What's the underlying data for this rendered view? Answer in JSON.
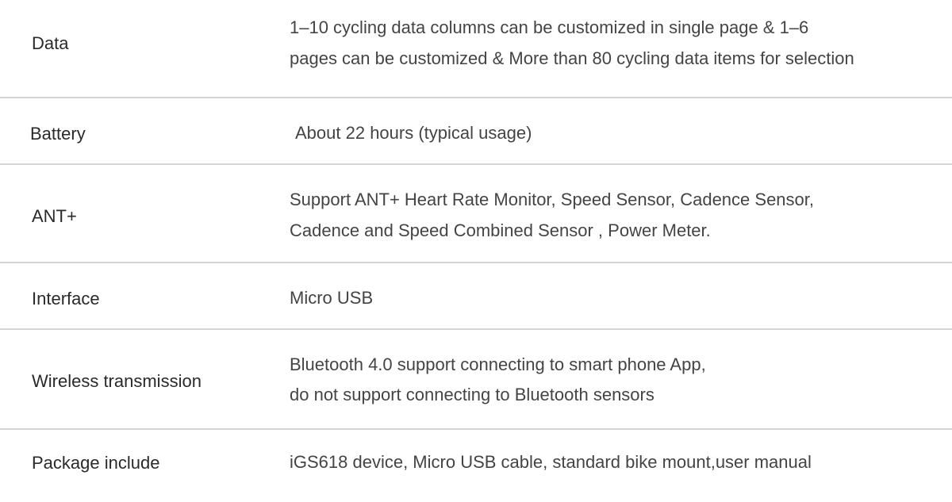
{
  "specs": [
    {
      "label": "Data",
      "lines": [
        "1–10 cycling data columns can be customized in single page & 1–6",
        "pages can be customized & More than 80 cycling data items for selection"
      ]
    },
    {
      "label": "Battery",
      "lines": [
        "About 22 hours (typical usage)"
      ]
    },
    {
      "label": "ANT+",
      "lines": [
        "Support ANT+ Heart Rate Monitor, Speed Sensor, Cadence Sensor,",
        "Cadence and Speed Combined Sensor , Power Meter."
      ]
    },
    {
      "label": "Interface",
      "lines": [
        "Micro USB"
      ]
    },
    {
      "label": "Wireless transmission",
      "lines": [
        "Bluetooth 4.0 support connecting to smart phone App,",
        "do not support connecting to Bluetooth sensors"
      ]
    },
    {
      "label": "Package include",
      "lines": [
        "iGS618 device, Micro USB cable, standard bike mount,user manual"
      ]
    }
  ]
}
